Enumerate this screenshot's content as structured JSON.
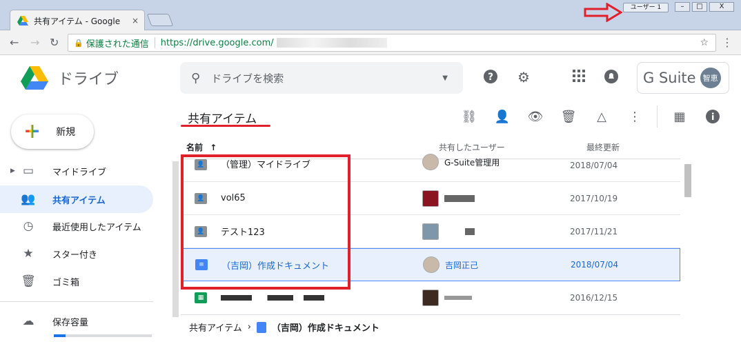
{
  "browser": {
    "tab_title": "共有アイテム - Google",
    "tab_close": "×",
    "user_button": "ユーザー 1",
    "win_min": "–",
    "win_max": "□",
    "win_close": "X",
    "secure_label": "保護された通信",
    "url": "https://drive.google.com/"
  },
  "header": {
    "brand": "ドライブ",
    "search_placeholder": "ドライブを検索",
    "gsuite_label": "G Suite",
    "avatar_text": "智恵"
  },
  "sidebar": {
    "new_label": "新規",
    "items": [
      {
        "label": "マイドライブ"
      },
      {
        "label": "共有アイテム"
      },
      {
        "label": "最近使用したアイテム"
      },
      {
        "label": "スター付き"
      },
      {
        "label": "ゴミ箱"
      },
      {
        "label": "保存容量"
      }
    ],
    "storage_used_fraction": 0.12
  },
  "main": {
    "title": "共有アイテム",
    "columns": {
      "name": "名前",
      "sort_arrow": "↑",
      "owner": "共有したユーザー",
      "modified": "最終更新"
    },
    "rows": [
      {
        "name": "（管理）マイドライブ",
        "owner": "G-Suite管理用",
        "modified": "2018/07/04"
      },
      {
        "name": "vol65",
        "owner": "",
        "modified": "2017/10/19"
      },
      {
        "name": "テスト123",
        "owner": "",
        "modified": "2017/11/21"
      },
      {
        "name": "（吉岡）作成ドキュメント",
        "owner": "吉岡正己",
        "modified": "2018/07/04"
      },
      {
        "name": "",
        "owner": "",
        "modified": "2016/12/15"
      }
    ],
    "breadcrumb": {
      "root": "共有アイテム",
      "sep": "›",
      "current": "（吉岡）作成ドキュメント"
    }
  },
  "colors": {
    "accent": "#1967d2",
    "annotation_red": "#e0202a",
    "selected_bg": "#e8f0fe"
  }
}
